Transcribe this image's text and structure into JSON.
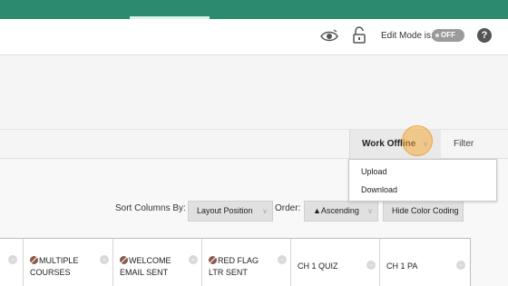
{
  "toolbar": {
    "edit_mode_label": "Edit Mode is:",
    "edit_mode_state": "OFF",
    "help_glyph": "?",
    "icons": [
      "student-preview-icon",
      "unlock-icon",
      "help-icon"
    ]
  },
  "actions": {
    "work_offline": "Work Offline",
    "filter": "Filter",
    "chevron": "∨"
  },
  "work_offline_menu": [
    "Upload",
    "Download"
  ],
  "sort": {
    "sort_columns_label": "Sort Columns By:",
    "layout_position": "Layout Position",
    "order_label": "Order:",
    "order_value": "▲Ascending",
    "hide_color_coding": "Hide Color Coding"
  },
  "grid": {
    "columns": [
      {
        "line1": "",
        "line2": ""
      },
      {
        "line1": "MULTIPLE",
        "line2": "COURSES",
        "hidden_icon": true
      },
      {
        "line1": "WELCOME",
        "line2": "EMAIL SENT",
        "hidden_icon": true
      },
      {
        "line1": "RED FLAG",
        "line2": "LTR SENT",
        "hidden_icon": true
      },
      {
        "line1": "CH 1 QUIZ",
        "line2": ""
      },
      {
        "line1": "CH 1 PA",
        "line2": ""
      }
    ],
    "menu_glyph": "⌄"
  },
  "colors": {
    "header": "#2c8a6f",
    "highlight": "#f5ab3c"
  }
}
